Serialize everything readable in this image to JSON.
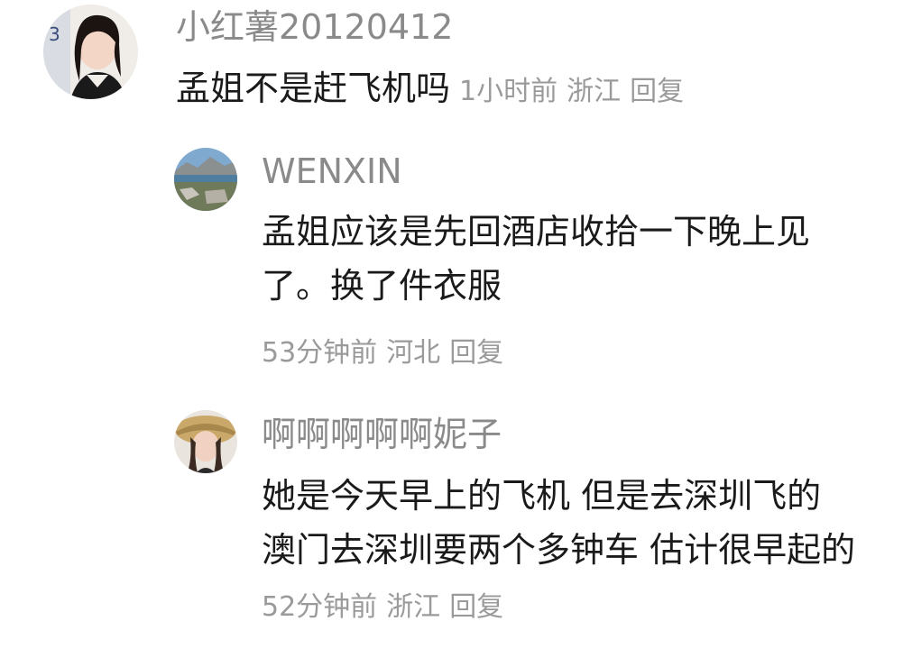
{
  "comments": [
    {
      "username": "小红薯20120412",
      "text": "孟姐不是赶飞机吗",
      "time": "1小时前",
      "location": "浙江",
      "reply_label": "回复"
    },
    {
      "username": "WENXIN",
      "text": "孟姐应该是先回酒店收拾一下晚上见了。换了件衣服",
      "time": "53分钟前",
      "location": "河北",
      "reply_label": "回复"
    },
    {
      "username": "啊啊啊啊啊妮子",
      "text": "她是今天早上的飞机 但是去深圳飞的 澳门去深圳要两个多钟车 估计很早起的",
      "time": "52分钟前",
      "location": "浙江",
      "reply_label": "回复"
    }
  ],
  "colors": {
    "username": "#8a8a8a",
    "meta": "#9a9a9a",
    "text": "#1a1a1a",
    "background": "#ffffff"
  }
}
